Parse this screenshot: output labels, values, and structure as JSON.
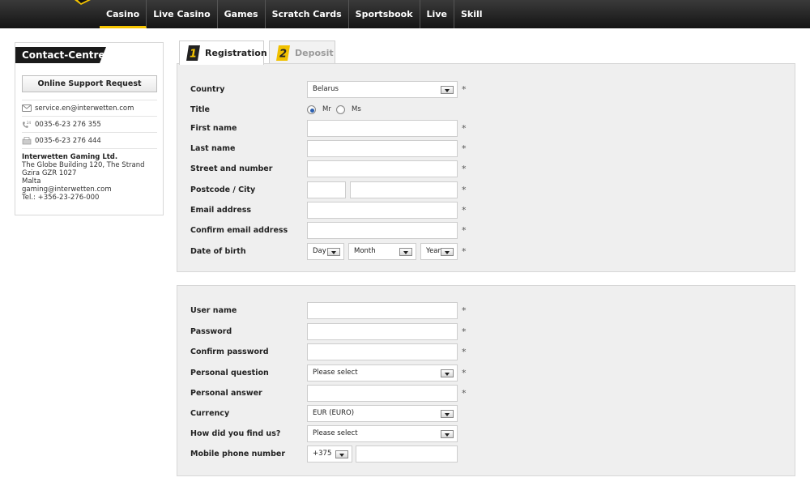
{
  "nav": {
    "items": [
      {
        "label": "Casino",
        "active": true
      },
      {
        "label": "Live Casino"
      },
      {
        "label": "Games"
      },
      {
        "label": "Scratch Cards"
      },
      {
        "label": "Sportsbook"
      },
      {
        "label": "Live"
      },
      {
        "label": "Skill"
      }
    ],
    "accent_color": "#f5c400"
  },
  "contact": {
    "title": "Contact-Centre",
    "support_button": "Online Support Request",
    "email": "service.en@interwetten.com",
    "phone": "0035-6-23 276 355",
    "phone_icon_text": "24",
    "fax": "0035-6-23 276 444",
    "company": "Interwetten Gaming Ltd.",
    "address_lines": [
      "The Globe Building 120, The Strand",
      "Gzira GZR 1027",
      "Malta",
      "gaming@interwetten.com",
      "Tel.: +356-23-276-000"
    ]
  },
  "tabs": [
    {
      "number": "1",
      "label": "Registration",
      "active": true
    },
    {
      "number": "2",
      "label": "Deposit",
      "active": false
    }
  ],
  "form1": {
    "country_label": "Country",
    "country_value": "Belarus",
    "title_label": "Title",
    "title_options": [
      "Mr",
      "Ms"
    ],
    "title_selected": "Mr",
    "first_name_label": "First name",
    "first_name_value": "",
    "last_name_label": "Last name",
    "last_name_value": "",
    "street_label": "Street and number",
    "street_value": "",
    "postcode_label": "Postcode / City",
    "postcode_value": "",
    "city_value": "",
    "email_label": "Email address",
    "email_value": "",
    "confirm_email_label": "Confirm email address",
    "confirm_email_value": "",
    "dob_label": "Date of birth",
    "dob_day": "Day",
    "dob_month": "Month",
    "dob_year": "Year"
  },
  "form2": {
    "username_label": "User name",
    "username_value": "",
    "password_label": "Password",
    "password_value": "",
    "confirm_password_label": "Confirm password",
    "confirm_password_value": "",
    "question_label": "Personal question",
    "question_value": "Please select",
    "answer_label": "Personal answer",
    "answer_value": "",
    "currency_label": "Currency",
    "currency_value": "EUR (EURO)",
    "found_label": "How did you find us?",
    "found_value": "Please select",
    "mobile_label": "Mobile phone number",
    "mobile_prefix": "+375",
    "mobile_value": ""
  },
  "required_marker": "*"
}
